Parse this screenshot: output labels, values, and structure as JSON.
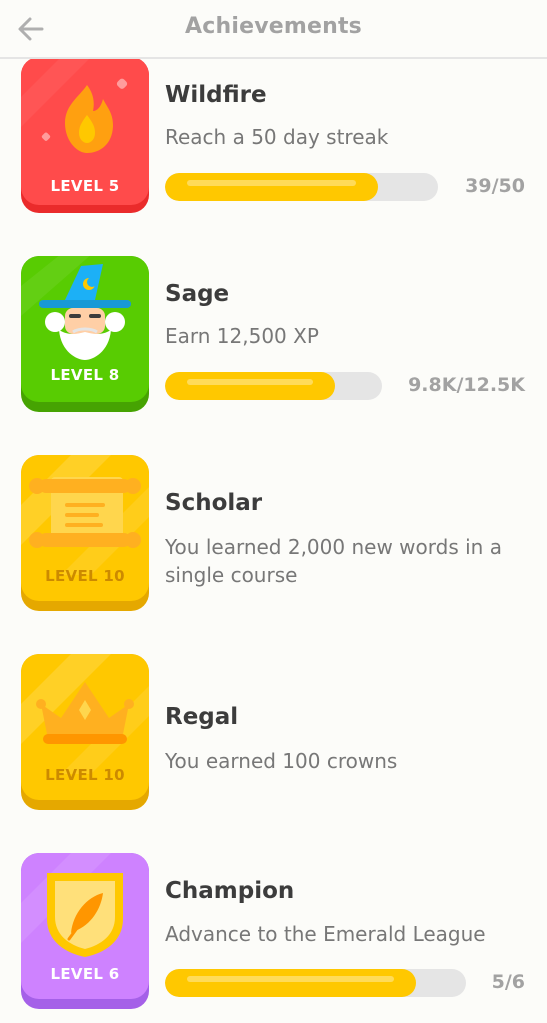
{
  "header": {
    "title": "Achievements",
    "back_icon": "arrow-left-icon"
  },
  "colors": {
    "progress_fill": "#ffc800",
    "progress_track": "#e5e5e5",
    "wildfire_badge": "#ff4b4b",
    "sage_badge": "#58cc02",
    "scholar_badge": "#ffc800",
    "regal_badge": "#ffc800",
    "champion_badge": "#ce82ff"
  },
  "achievements": [
    {
      "name": "Wildfire",
      "level": "LEVEL 5",
      "description": "Reach a 50 day streak",
      "progress_text": "39/50",
      "progress": 0.78,
      "icon": "flame-icon"
    },
    {
      "name": "Sage",
      "level": "LEVEL 8",
      "description": "Earn 12,500 XP",
      "progress_text": "9.8K/12.5K",
      "progress": 0.784,
      "icon": "wizard-icon"
    },
    {
      "name": "Scholar",
      "level": "LEVEL 10",
      "description": "You learned 2,000 new words in a single course",
      "icon": "scroll-icon"
    },
    {
      "name": "Regal",
      "level": "LEVEL 10",
      "description": "You earned 100 crowns",
      "icon": "crown-icon"
    },
    {
      "name": "Champion",
      "level": "LEVEL 6",
      "description": "Advance to the Emerald League",
      "progress_text": "5/6",
      "progress": 0.833,
      "icon": "feather-shield-icon"
    }
  ]
}
